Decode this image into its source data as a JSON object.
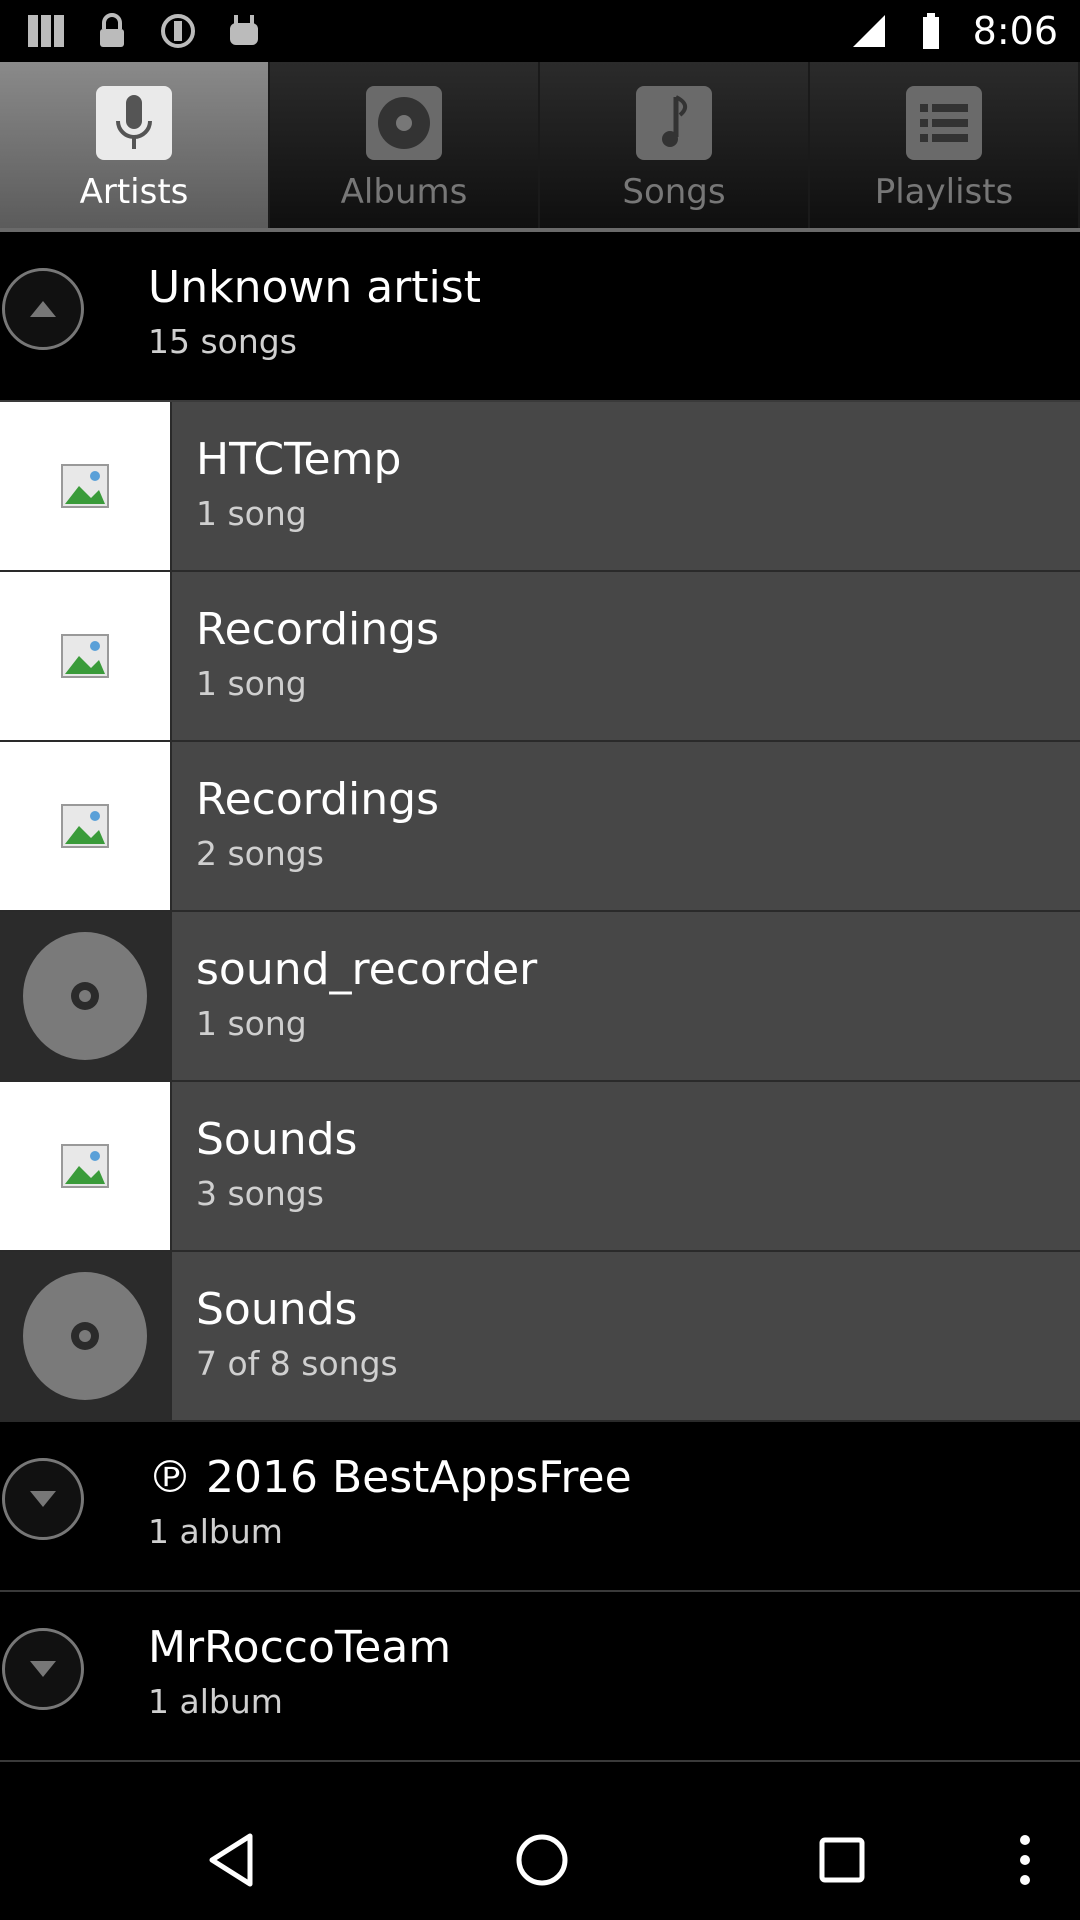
{
  "status_bar": {
    "time": "8:06",
    "icons": [
      "app-grid-icon",
      "lock-icon",
      "settings-icon",
      "android-icon"
    ]
  },
  "tabs": [
    {
      "label": "Artists",
      "icon": "microphone-icon",
      "active": true
    },
    {
      "label": "Albums",
      "icon": "disc-icon",
      "active": false
    },
    {
      "label": "Songs",
      "icon": "music-note-icon",
      "active": false
    },
    {
      "label": "Playlists",
      "icon": "list-icon",
      "active": false
    }
  ],
  "list": {
    "group1": {
      "title": "Unknown artist",
      "subtitle": "15 songs"
    },
    "items": [
      {
        "title": "HTCTemp",
        "subtitle": "1 song"
      },
      {
        "title": "Recordings",
        "subtitle": "1 song"
      },
      {
        "title": "Recordings",
        "subtitle": "2 songs"
      },
      {
        "title": "sound_recorder",
        "subtitle": "1 song"
      },
      {
        "title": "Sounds",
        "subtitle": "3 songs"
      },
      {
        "title": "Sounds",
        "subtitle": "7 of 8 songs"
      }
    ],
    "group2": {
      "title": "℗ 2016 BestAppsFree",
      "subtitle": "1 album"
    },
    "group3": {
      "title": "MrRoccoTeam",
      "subtitle": "1 album"
    }
  },
  "nav": {
    "icons": [
      "back-icon",
      "home-icon",
      "recents-icon",
      "overflow-menu-icon"
    ]
  }
}
